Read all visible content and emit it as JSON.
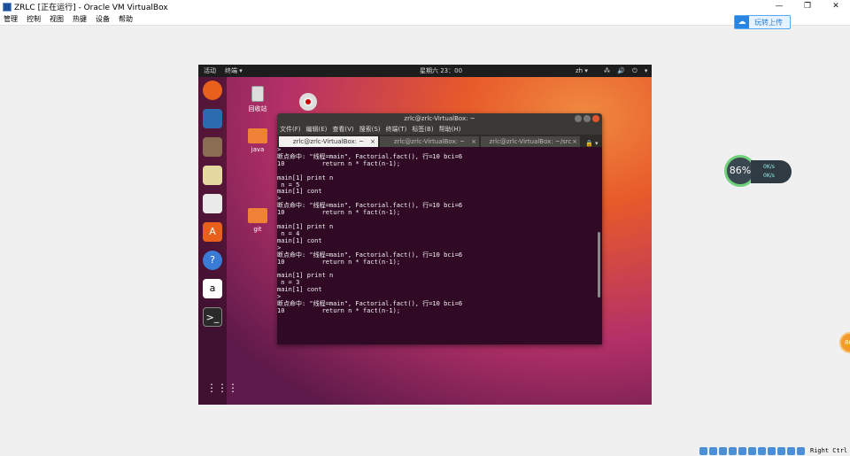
{
  "window": {
    "title": "ZRLC [正在运行] - Oracle VM VirtualBox",
    "controls": [
      "—",
      "❐",
      "✕"
    ]
  },
  "menubar": {
    "items": [
      "管理",
      "控制",
      "视图",
      "热键",
      "设备",
      "帮助"
    ]
  },
  "cloud_button": {
    "label": "玩转上传"
  },
  "guest": {
    "topbar": {
      "activities": "活动",
      "app": "终端 ▾",
      "clock": "星期六 23：00",
      "lang": "zh ▾",
      "sys": "⁂ 🔊 ⏻ ▾"
    },
    "desktop": {
      "trash": "回收站",
      "java": "java",
      "git": "git"
    },
    "terminal": {
      "title": "zrlc@zrlc-VirtualBox: ~",
      "menu": [
        "文件(F)",
        "编辑(E)",
        "查看(V)",
        "搜索(S)",
        "终端(T)",
        "标签(B)",
        "帮助(H)"
      ],
      "tabs": [
        "zrlc@zrlc-VirtualBox: ~",
        "zrlc@zrlc-VirtualBox: ~",
        "zrlc@zrlc-VirtualBox: ~/src"
      ],
      "lines": [
        ">",
        "断点命中: \"线程=main\", Factorial.fact(), 行=10 bci=6",
        "10          return n * fact(n-1);",
        "",
        "main[1] print n",
        " n = 5",
        "main[1] cont",
        ">",
        "断点命中: \"线程=main\", Factorial.fact(), 行=10 bci=6",
        "10          return n * fact(n-1);",
        "",
        "main[1] print n",
        " n = 4",
        "main[1] cont",
        ">",
        "断点命中: \"线程=main\", Factorial.fact(), 行=10 bci=6",
        "10          return n * fact(n-1);",
        "",
        "main[1] print n",
        " n = 3",
        "main[1] cont",
        ">",
        "断点命中: \"线程=main\", Factorial.fact(), 行=10 bci=6",
        "10          return n * fact(n-1);"
      ]
    }
  },
  "gauge": {
    "percent": "86%",
    "up": "0K/s",
    "down": "0K/s"
  },
  "bubble": {
    "text": "86"
  },
  "statusbar": {
    "host_key": "Right Ctrl"
  }
}
